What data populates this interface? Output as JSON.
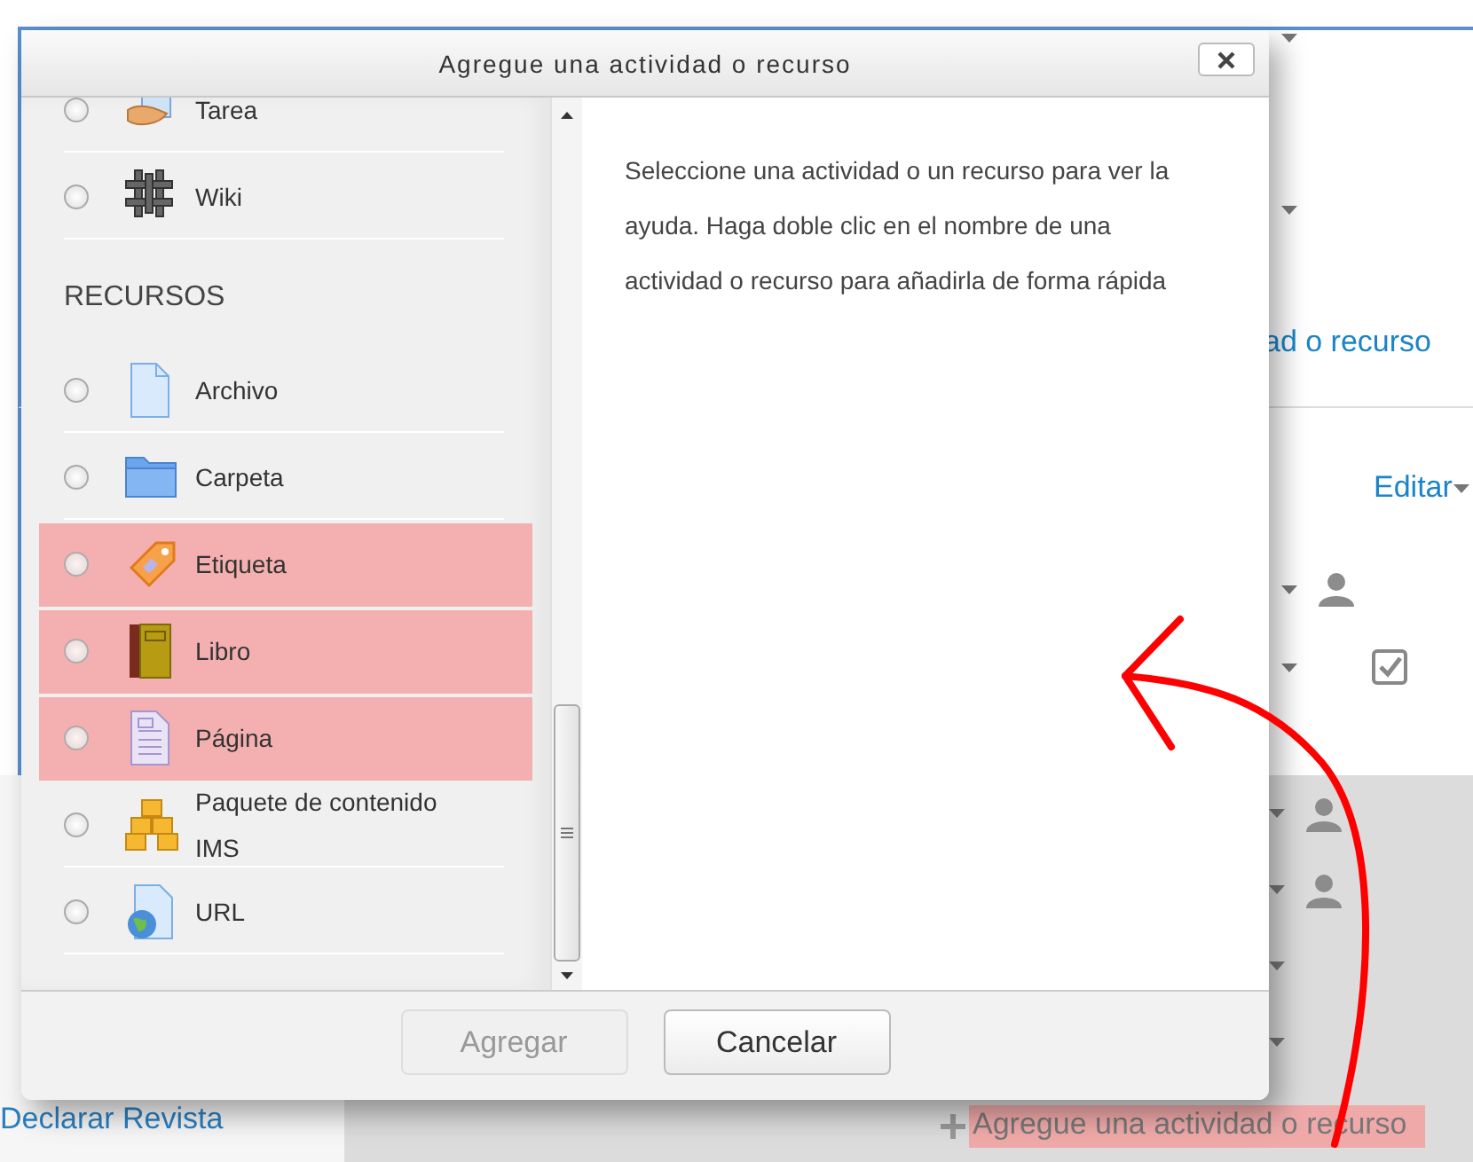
{
  "background": {
    "link_partial": "ad o recurso",
    "edit_menu": "Editar",
    "sidebar_link": "Declarar Revista",
    "add_link": "Agregue una actividad o recurso",
    "add_link_highlighted": true
  },
  "dialog": {
    "title": "Agregue una actividad o recurso",
    "items": [
      {
        "kind": "option",
        "label": "Tarea",
        "selected": false,
        "highlighted": false
      },
      {
        "kind": "option",
        "label": "Wiki",
        "selected": false,
        "highlighted": false
      },
      {
        "kind": "heading",
        "label": "RECURSOS"
      },
      {
        "kind": "option",
        "label": "Archivo",
        "selected": false,
        "highlighted": false
      },
      {
        "kind": "option",
        "label": "Carpeta",
        "selected": false,
        "highlighted": false
      },
      {
        "kind": "option",
        "label": "Etiqueta",
        "selected": false,
        "highlighted": true
      },
      {
        "kind": "option",
        "label": "Libro",
        "selected": false,
        "highlighted": true
      },
      {
        "kind": "option",
        "label": "Página",
        "selected": false,
        "highlighted": true
      },
      {
        "kind": "option",
        "label": "Paquete de contenido IMS",
        "selected": false,
        "highlighted": false
      },
      {
        "kind": "option",
        "label": "URL",
        "selected": false,
        "highlighted": false
      }
    ],
    "help_text": "Seleccione una actividad o un recurso para ver la ayuda. Haga doble clic en el nombre de una actividad o recurso para añadirla de forma rápida",
    "buttons": [
      {
        "label": "Agregar",
        "disabled": true
      },
      {
        "label": "Cancelar",
        "disabled": false
      }
    ]
  }
}
